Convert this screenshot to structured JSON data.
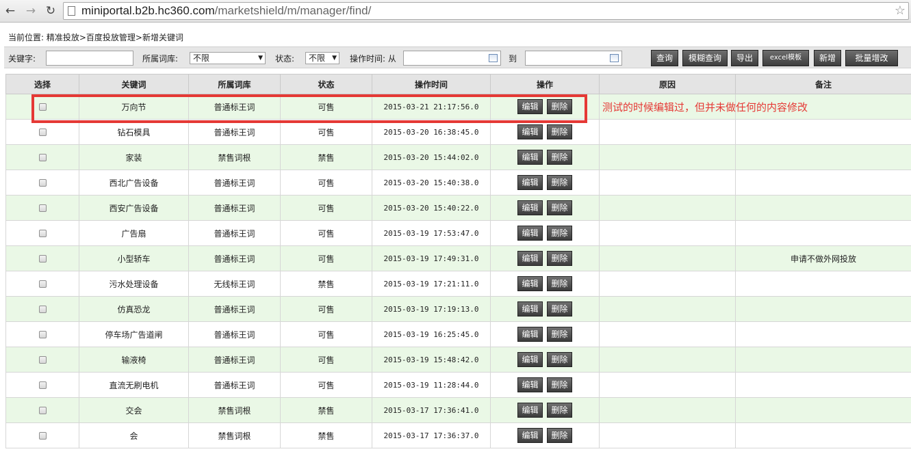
{
  "browser": {
    "url_host": "miniportal.b2b.hc360.com",
    "url_path": "/marketshield/m/manager/find/"
  },
  "breadcrumb": "当前位置: 精准投放>百度投放管理>新增关键词",
  "search": {
    "keyword_label": "关键字:",
    "keyword_value": "",
    "library_label": "所属词库:",
    "library_value": "不限",
    "status_label": "状态:",
    "status_value": "不限",
    "time_label": "操作时间: 从",
    "to_label": "到",
    "buttons": {
      "query": "查询",
      "fuzzy": "模糊查询",
      "export": "导出",
      "template": "excel模板",
      "add": "新增",
      "batch_add": "批量增改"
    }
  },
  "table": {
    "headers": [
      "选择",
      "关键词",
      "所属词库",
      "状态",
      "操作时间",
      "操作",
      "原因",
      "备注"
    ],
    "edit_label": "编辑",
    "delete_label": "删除",
    "rows": [
      {
        "keyword": "万向节",
        "library": "普通标王词",
        "status": "可售",
        "time": "2015-03-21 21:17:56.0",
        "reason": "",
        "note": ""
      },
      {
        "keyword": "钻石模具",
        "library": "普通标王词",
        "status": "可售",
        "time": "2015-03-20 16:38:45.0",
        "reason": "",
        "note": ""
      },
      {
        "keyword": "家装",
        "library": "禁售词根",
        "status": "禁售",
        "time": "2015-03-20 15:44:02.0",
        "reason": "",
        "note": ""
      },
      {
        "keyword": "西北广告设备",
        "library": "普通标王词",
        "status": "可售",
        "time": "2015-03-20 15:40:38.0",
        "reason": "",
        "note": ""
      },
      {
        "keyword": "西安广告设备",
        "library": "普通标王词",
        "status": "可售",
        "time": "2015-03-20 15:40:22.0",
        "reason": "",
        "note": ""
      },
      {
        "keyword": "广告扇",
        "library": "普通标王词",
        "status": "可售",
        "time": "2015-03-19 17:53:47.0",
        "reason": "",
        "note": ""
      },
      {
        "keyword": "小型轿车",
        "library": "普通标王词",
        "status": "可售",
        "time": "2015-03-19 17:49:31.0",
        "reason": "",
        "note": "申请不做外网投放"
      },
      {
        "keyword": "污水处理设备",
        "library": "无线标王词",
        "status": "禁售",
        "time": "2015-03-19 17:21:11.0",
        "reason": "",
        "note": ""
      },
      {
        "keyword": "仿真恐龙",
        "library": "普通标王词",
        "status": "可售",
        "time": "2015-03-19 17:19:13.0",
        "reason": "",
        "note": ""
      },
      {
        "keyword": "停车场广告道闸",
        "library": "普通标王词",
        "status": "可售",
        "time": "2015-03-19 16:25:45.0",
        "reason": "",
        "note": ""
      },
      {
        "keyword": "输液椅",
        "library": "普通标王词",
        "status": "可售",
        "time": "2015-03-19 15:48:42.0",
        "reason": "",
        "note": ""
      },
      {
        "keyword": "直流无刷电机",
        "library": "普通标王词",
        "status": "可售",
        "time": "2015-03-19 11:28:44.0",
        "reason": "",
        "note": ""
      },
      {
        "keyword": "交会",
        "library": "禁售词根",
        "status": "禁售",
        "time": "2015-03-17 17:36:41.0",
        "reason": "",
        "note": ""
      },
      {
        "keyword": "会",
        "library": "禁售词根",
        "status": "禁售",
        "time": "2015-03-17 17:36:37.0",
        "reason": "",
        "note": ""
      }
    ]
  },
  "annotation": {
    "text": "测试的时候编辑过，但并未做任何的内容修改",
    "color": "#e53935"
  }
}
